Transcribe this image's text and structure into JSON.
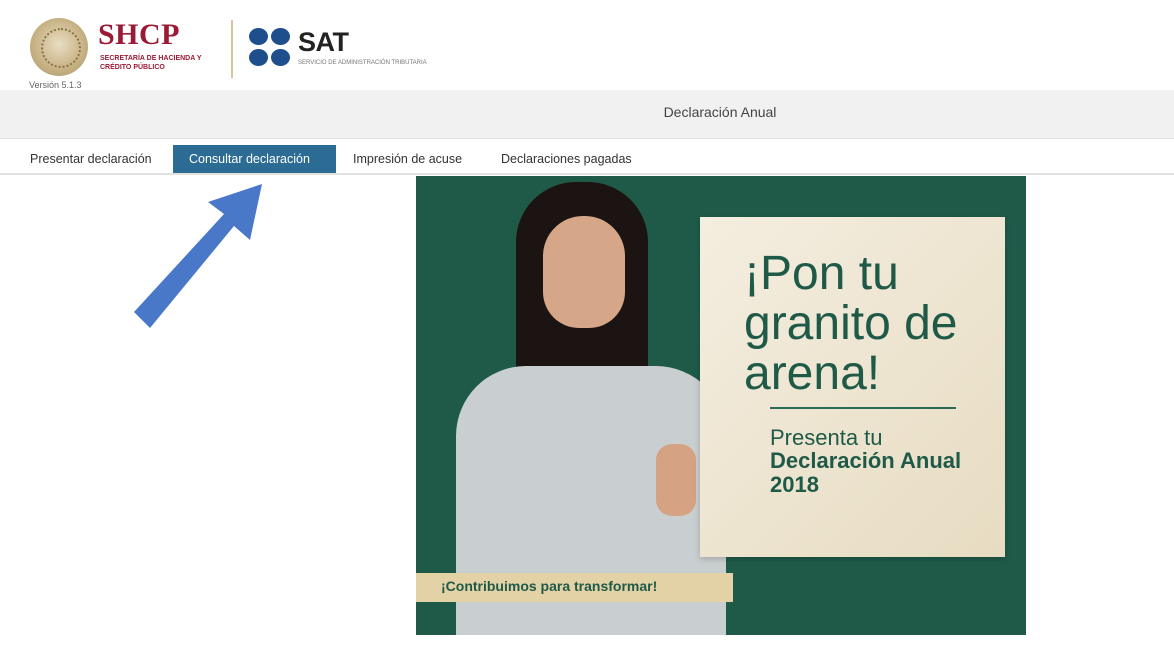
{
  "header": {
    "shcp_title": "SHCP",
    "shcp_subtitle": "SECRETARÍA DE HACIENDA Y CRÉDITO PÚBLICO",
    "version": "Versión 5.1.3",
    "sat_title": "SAT",
    "sat_subtitle": "SERVICIO DE ADMINISTRACIÓN TRIBUTARIA"
  },
  "page_title": "Declaración Anual",
  "tabs": [
    {
      "label": "Presentar declaración",
      "active": false
    },
    {
      "label": "Consultar declaración",
      "active": true
    },
    {
      "label": "Impresión de acuse",
      "active": false
    },
    {
      "label": "Declaraciones pagadas",
      "active": false
    }
  ],
  "banner": {
    "headline": "¡Pon tu granito de arena!",
    "line1": "Presenta tu",
    "line2": "Declaración Anual 2018",
    "ribbon": "¡Contribuimos para transformar!"
  },
  "colors": {
    "accent_tab": "#2c6c94",
    "shcp_red": "#9a1b36",
    "sat_blue": "#1f4e8c",
    "banner_green": "#1f5a48",
    "arrow_blue": "#4a78c9"
  }
}
